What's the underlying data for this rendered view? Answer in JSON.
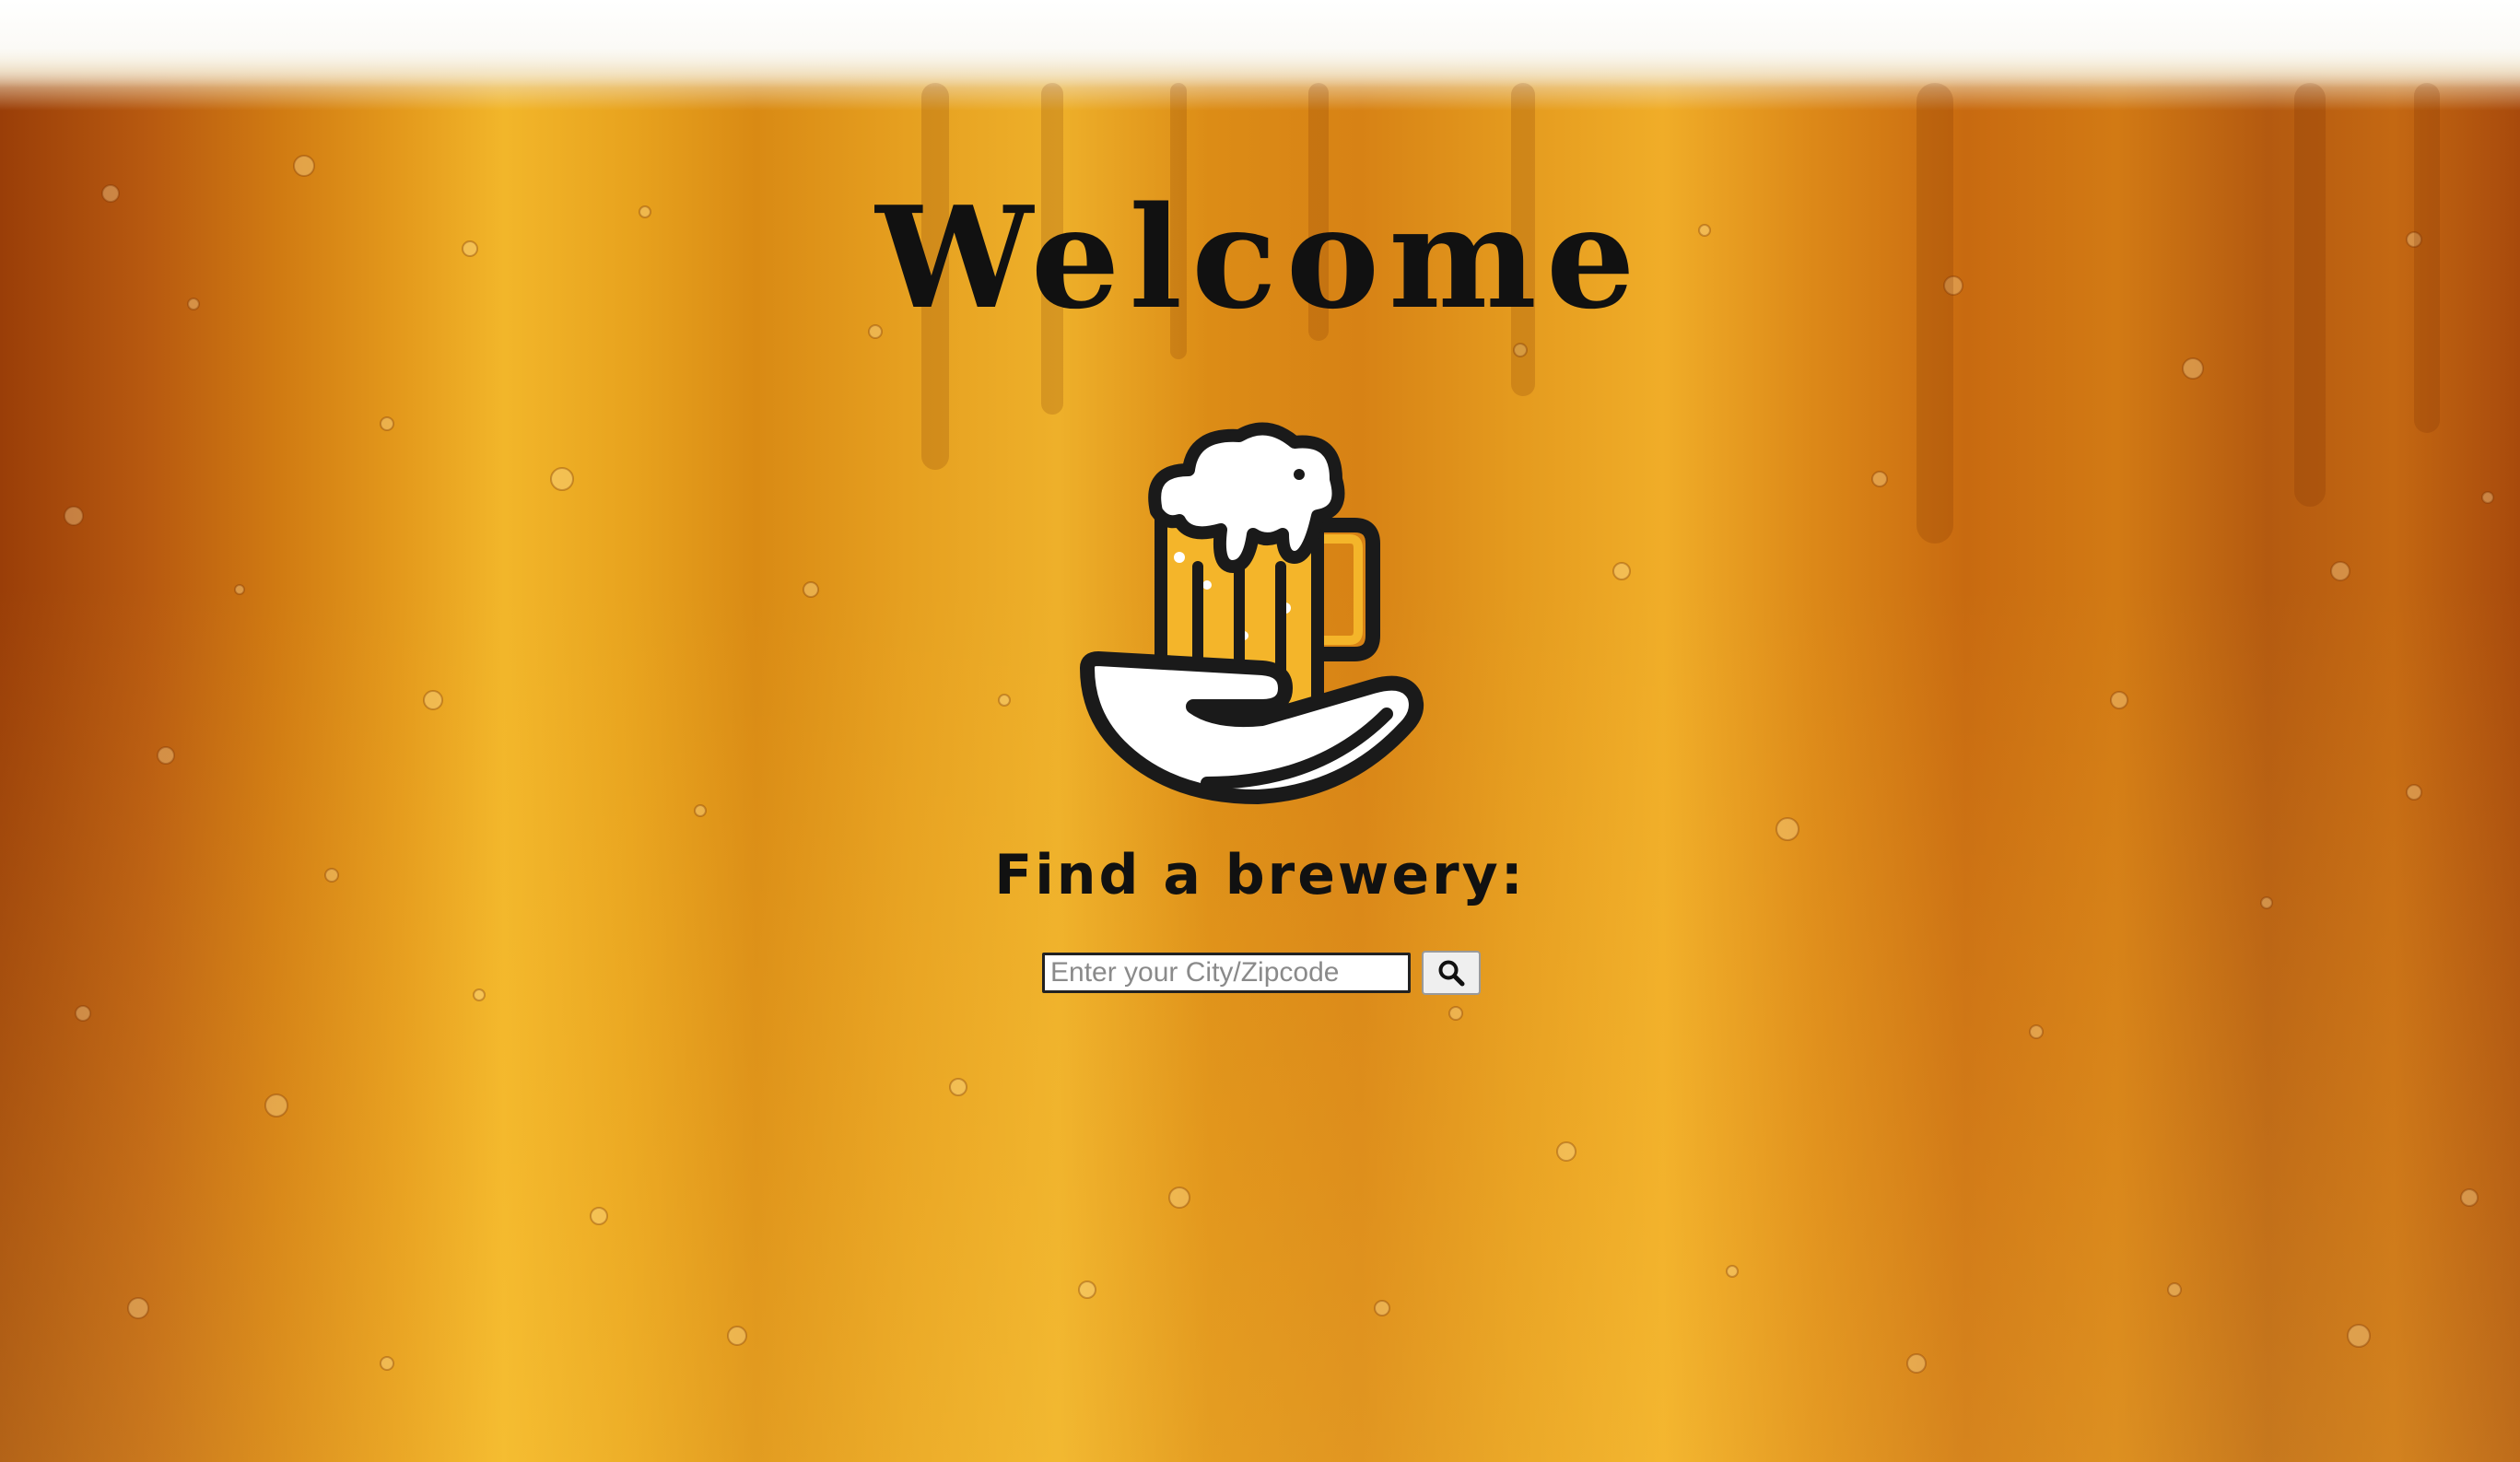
{
  "page": {
    "title": "Welcome",
    "subtitle": "Find a brewery:"
  },
  "search": {
    "placeholder": "Enter your City/Zipcode",
    "value": "",
    "button_icon": "search-icon"
  },
  "logo": {
    "icon": "beer-mug-in-hand-icon"
  },
  "colors": {
    "beer_gold": "#F4B52A",
    "beer_amber": "#D07A12",
    "text": "#111111",
    "foam": "#FFFFFF"
  }
}
